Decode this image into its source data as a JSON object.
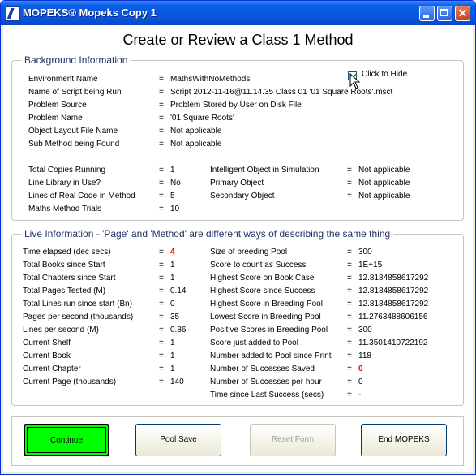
{
  "window": {
    "title": "MOPEKS® Mopeks Copy 1"
  },
  "heading": "Create or Review a Class 1 Method",
  "background": {
    "title": "Background Information",
    "hide_label": "Click to Hide",
    "rows_top": [
      {
        "label": "Environment Name",
        "value": "MathsWithNoMethods"
      },
      {
        "label": "Name of Script being Run",
        "value": "Script 2012-11-16@11.14.35 Class 01 '01 Square Roots'.msct"
      },
      {
        "label": "Problem Source",
        "value": "Problem Stored by User on Disk File"
      },
      {
        "label": "Problem Name",
        "value": "'01    Square Roots'"
      },
      {
        "label": "Object Layout File Name",
        "value": "Not applicable"
      },
      {
        "label": "Sub Method being Found",
        "value": "Not applicable"
      }
    ],
    "rows_left": [
      {
        "label": "Total Copies Running",
        "value": "1"
      },
      {
        "label": "Line Library in Use?",
        "value": "No"
      },
      {
        "label": "Lines of Real Code in Method",
        "value": "5"
      },
      {
        "label": "Maths Method Trials",
        "value": "10"
      }
    ],
    "rows_right": [
      {
        "label": "Intelligent Object in Simulation",
        "value": "Not applicable"
      },
      {
        "label": "Primary Object",
        "value": "Not applicable"
      },
      {
        "label": "Secondary Object",
        "value": "Not applicable"
      }
    ]
  },
  "live": {
    "title": "Live Information - 'Page' and 'Method' are different ways of describing the same thing",
    "rows_left": [
      {
        "label": "Time elapsed (dec secs)",
        "value": "4",
        "highlight": true
      },
      {
        "label": "Total Books since Start",
        "value": "1"
      },
      {
        "label": "Total Chapters since Start",
        "value": "1"
      },
      {
        "label": "Total Pages Tested (M)",
        "value": "0.14"
      },
      {
        "label": "Total Lines run since start (Bn)",
        "value": "0"
      },
      {
        "label": "Pages per second (thousands)",
        "value": "35"
      },
      {
        "label": "Lines per second (M)",
        "value": "0.86"
      },
      {
        "label": "Current Shelf",
        "value": "1"
      },
      {
        "label": "Current Book",
        "value": "1"
      },
      {
        "label": "Current Chapter",
        "value": "1"
      },
      {
        "label": "Current Page (thousands)",
        "value": "140"
      }
    ],
    "rows_right": [
      {
        "label": "Size of breeding Pool",
        "value": "300"
      },
      {
        "label": "Score to count as Success",
        "value": "1E+15"
      },
      {
        "label": "Highest Score on Book Case",
        "value": "12.8184858617292"
      },
      {
        "label": "Highest Score since Success",
        "value": "12.8184858617292"
      },
      {
        "label": "Highest Score in Breeding Pool",
        "value": "12.8184858617292"
      },
      {
        "label": "Lowest Score in Breeding Pool",
        "value": "11.2763488606156"
      },
      {
        "label": "Positive Scores in Breeding Pool",
        "value": "300"
      },
      {
        "label": "Score just added to Pool",
        "value": "11.3501410722192"
      },
      {
        "label": "Number added to Pool since Print",
        "value": "118"
      },
      {
        "label": "Number of Successes Saved",
        "value": "0",
        "highlight": true
      },
      {
        "label": "Number of Successes per hour",
        "value": "0"
      },
      {
        "label": "Time since Last Success (secs)",
        "value": "-"
      }
    ]
  },
  "buttons": {
    "continue": "Continue",
    "pool_save": "Pool Save",
    "reset_form": "Reset Form",
    "end": "End MOPEKS"
  }
}
